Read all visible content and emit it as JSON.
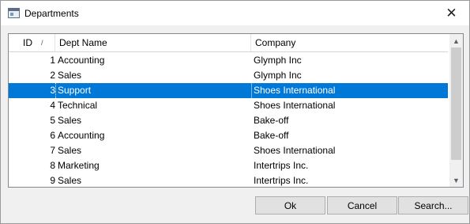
{
  "window": {
    "title": "Departments",
    "close_glyph": "✕"
  },
  "table": {
    "columns": [
      "ID",
      "Dept Name",
      "Company"
    ],
    "sort_indicator": "/",
    "selected_index": 2,
    "rows": [
      {
        "id": "1",
        "dept_name": "Accounting",
        "company": "Glymph Inc"
      },
      {
        "id": "2",
        "dept_name": "Sales",
        "company": "Glymph Inc"
      },
      {
        "id": "3",
        "dept_name": "Support",
        "company": "Shoes International"
      },
      {
        "id": "4",
        "dept_name": "Technical",
        "company": "Shoes International"
      },
      {
        "id": "5",
        "dept_name": "Sales",
        "company": "Bake-off"
      },
      {
        "id": "6",
        "dept_name": "Accounting",
        "company": "Bake-off"
      },
      {
        "id": "7",
        "dept_name": "Sales",
        "company": "Shoes International"
      },
      {
        "id": "8",
        "dept_name": "Marketing",
        "company": "Intertrips Inc."
      },
      {
        "id": "9",
        "dept_name": "Sales",
        "company": "Intertrips Inc."
      }
    ]
  },
  "scrollbar": {
    "up_glyph": "▲",
    "down_glyph": "▼"
  },
  "buttons": {
    "ok": "Ok",
    "cancel": "Cancel",
    "search": "Search..."
  },
  "colors": {
    "selection": "#0078d7",
    "button_face": "#e1e1e1"
  }
}
